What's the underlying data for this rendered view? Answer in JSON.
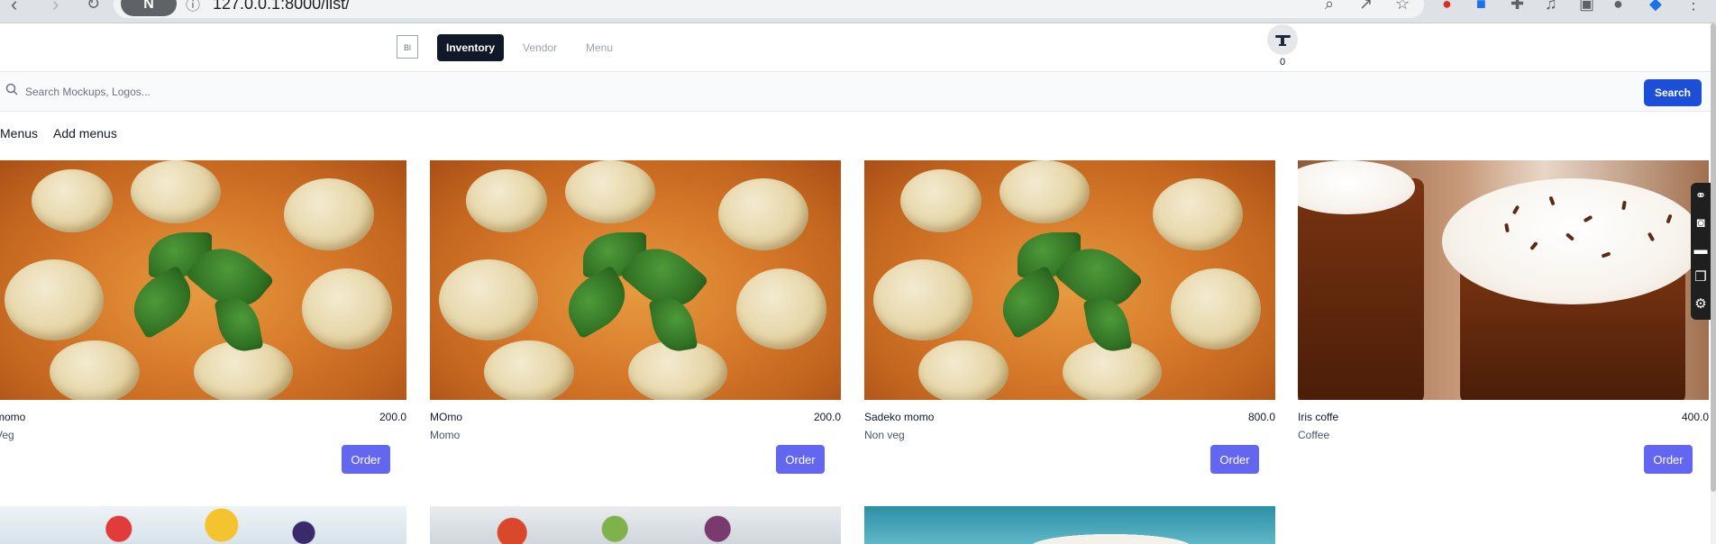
{
  "browser": {
    "url": "127.0.0.1:8000/list/",
    "incognito_label": "N"
  },
  "navbar": {
    "logo_alt": "Bl",
    "links": [
      {
        "label": "Inventory",
        "active": true
      },
      {
        "label": "Vendor",
        "active": false
      },
      {
        "label": "Menu",
        "active": false
      }
    ],
    "cart_count": "0"
  },
  "search": {
    "placeholder": "Search Mockups, Logos...",
    "value": "",
    "button_label": "Search"
  },
  "sublinks": {
    "menus": "Menus",
    "add_menus": "Add menus"
  },
  "cards": [
    {
      "name": "momo",
      "price": "200.0",
      "category": "Veg",
      "order_label": "Order",
      "image": "momo"
    },
    {
      "name": "MOmo",
      "price": "200.0",
      "category": "Momo",
      "order_label": "Order",
      "image": "momo"
    },
    {
      "name": "Sadeko momo",
      "price": "800.0",
      "category": "Non veg",
      "order_label": "Order",
      "image": "momo"
    },
    {
      "name": "Iris coffe",
      "price": "400.0",
      "category": "Coffee",
      "order_label": "Order",
      "image": "coffee"
    }
  ],
  "colors": {
    "primary_button": "#1d4ed8",
    "order_button": "#6366f1",
    "active_nav": "#111827"
  }
}
